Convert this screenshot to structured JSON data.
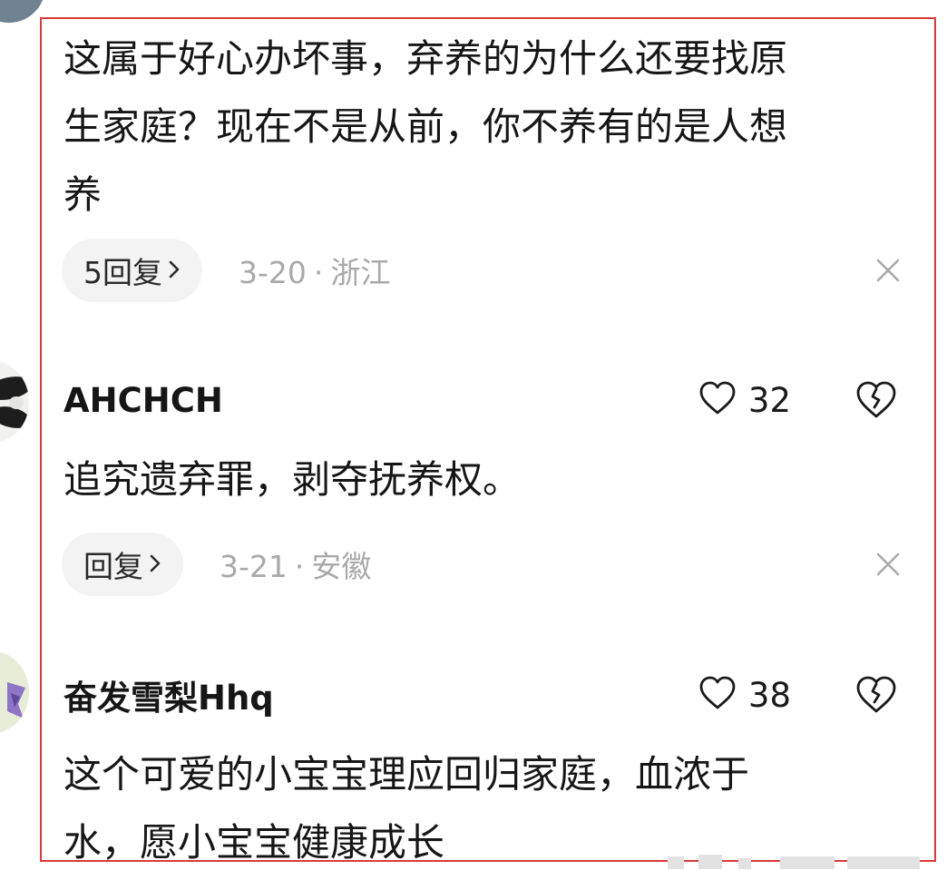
{
  "comments": [
    {
      "text_lines": [
        "这属于好心办坏事，弃养的为什么还要找原",
        "生家庭？现在不是从前，你不养有的是人想",
        "养"
      ],
      "reply_label": "5回复",
      "date": "3-20",
      "separator": "·",
      "location": "浙江"
    },
    {
      "username": "AHCHCH",
      "likes": "32",
      "text_lines": [
        "追究遗弃罪，剥夺抚养权。"
      ],
      "reply_label": "回复",
      "date": "3-21",
      "separator": "·",
      "location": "安徽"
    },
    {
      "username": "奋发雪梨Hhq",
      "likes": "38",
      "text_lines": [
        "这个可爱的小宝宝理应回归家庭，血浓于",
        "水，愿小宝宝健康成长"
      ]
    }
  ],
  "icons": {
    "chevron": "chevron-right-icon",
    "close": "close-icon",
    "like": "heart-outline-icon",
    "dislike": "broken-heart-icon"
  },
  "colors": {
    "highlight_border": "#d83a3a",
    "meta_text": "#a9a9a9",
    "pill_background": "#f3f3f3",
    "primary_text": "#161616"
  }
}
